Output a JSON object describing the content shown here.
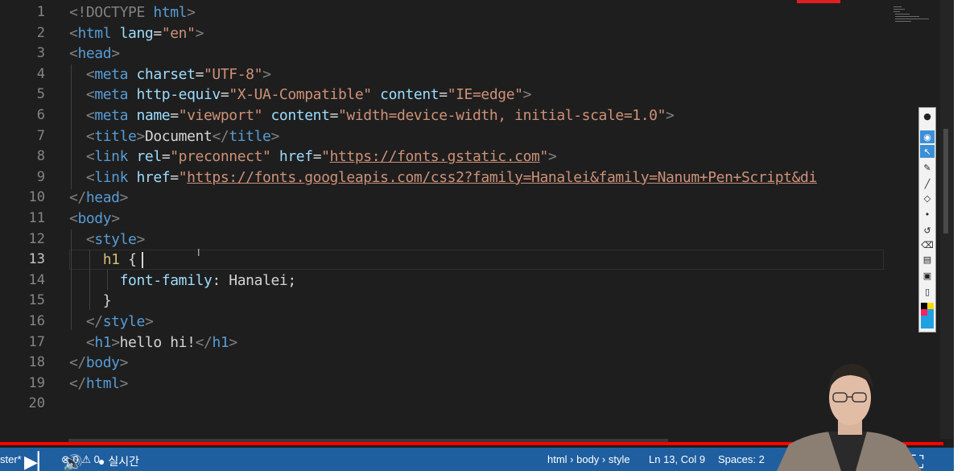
{
  "editor": {
    "current_line": 13,
    "line_numbers": [
      "1",
      "2",
      "3",
      "4",
      "5",
      "6",
      "7",
      "8",
      "9",
      "10",
      "11",
      "12",
      "13",
      "14",
      "15",
      "16",
      "17",
      "18",
      "19",
      "20"
    ],
    "lines": [
      [
        {
          "t": "<!DOCTYPE ",
          "c": "brk"
        },
        {
          "t": "html",
          "c": "tag"
        },
        {
          "t": ">",
          "c": "brk"
        }
      ],
      [
        {
          "t": "<",
          "c": "brk"
        },
        {
          "t": "html",
          "c": "tag"
        },
        {
          "t": " lang",
          "c": "attr"
        },
        {
          "t": "=",
          "c": "txt"
        },
        {
          "t": "\"en\"",
          "c": "str"
        },
        {
          "t": ">",
          "c": "brk"
        }
      ],
      [
        {
          "t": "<",
          "c": "brk"
        },
        {
          "t": "head",
          "c": "tag"
        },
        {
          "t": ">",
          "c": "brk"
        }
      ],
      [
        {
          "t": "  <",
          "c": "brk"
        },
        {
          "t": "meta",
          "c": "tag"
        },
        {
          "t": " charset",
          "c": "attr"
        },
        {
          "t": "=",
          "c": "txt"
        },
        {
          "t": "\"UTF-8\"",
          "c": "str"
        },
        {
          "t": ">",
          "c": "brk"
        }
      ],
      [
        {
          "t": "  <",
          "c": "brk"
        },
        {
          "t": "meta",
          "c": "tag"
        },
        {
          "t": " http-equiv",
          "c": "attr"
        },
        {
          "t": "=",
          "c": "txt"
        },
        {
          "t": "\"X-UA-Compatible\"",
          "c": "str"
        },
        {
          "t": " content",
          "c": "attr"
        },
        {
          "t": "=",
          "c": "txt"
        },
        {
          "t": "\"IE=edge\"",
          "c": "str"
        },
        {
          "t": ">",
          "c": "brk"
        }
      ],
      [
        {
          "t": "  <",
          "c": "brk"
        },
        {
          "t": "meta",
          "c": "tag"
        },
        {
          "t": " name",
          "c": "attr"
        },
        {
          "t": "=",
          "c": "txt"
        },
        {
          "t": "\"viewport\"",
          "c": "str"
        },
        {
          "t": " content",
          "c": "attr"
        },
        {
          "t": "=",
          "c": "txt"
        },
        {
          "t": "\"width=device-width, initial-scale=1.0\"",
          "c": "str"
        },
        {
          "t": ">",
          "c": "brk"
        }
      ],
      [
        {
          "t": "  <",
          "c": "brk"
        },
        {
          "t": "title",
          "c": "tag"
        },
        {
          "t": ">",
          "c": "brk"
        },
        {
          "t": "Document",
          "c": "txt"
        },
        {
          "t": "</",
          "c": "brk"
        },
        {
          "t": "title",
          "c": "tag"
        },
        {
          "t": ">",
          "c": "brk"
        }
      ],
      [
        {
          "t": "  <",
          "c": "brk"
        },
        {
          "t": "link",
          "c": "tag"
        },
        {
          "t": " rel",
          "c": "attr"
        },
        {
          "t": "=",
          "c": "txt"
        },
        {
          "t": "\"preconnect\"",
          "c": "str"
        },
        {
          "t": " href",
          "c": "attr"
        },
        {
          "t": "=",
          "c": "txt"
        },
        {
          "t": "\"",
          "c": "str"
        },
        {
          "t": "https://fonts.gstatic.com",
          "c": "url"
        },
        {
          "t": "\"",
          "c": "str"
        },
        {
          "t": ">",
          "c": "brk"
        }
      ],
      [
        {
          "t": "  <",
          "c": "brk"
        },
        {
          "t": "link",
          "c": "tag"
        },
        {
          "t": " href",
          "c": "attr"
        },
        {
          "t": "=",
          "c": "txt"
        },
        {
          "t": "\"",
          "c": "str"
        },
        {
          "t": "https://fonts.googleapis.com/css2?family=Hanalei&family=Nanum+Pen+Script&di",
          "c": "url"
        }
      ],
      [
        {
          "t": "</",
          "c": "brk"
        },
        {
          "t": "head",
          "c": "tag"
        },
        {
          "t": ">",
          "c": "brk"
        }
      ],
      [
        {
          "t": "<",
          "c": "brk"
        },
        {
          "t": "body",
          "c": "tag"
        },
        {
          "t": ">",
          "c": "brk"
        }
      ],
      [
        {
          "t": "  <",
          "c": "brk"
        },
        {
          "t": "style",
          "c": "tag"
        },
        {
          "t": ">",
          "c": "brk"
        }
      ],
      [
        {
          "t": "    h1 ",
          "c": "sel"
        },
        {
          "t": "{",
          "c": "txt"
        }
      ],
      [
        {
          "t": "      font-family",
          "c": "prop"
        },
        {
          "t": ": Hanalei;",
          "c": "txt"
        }
      ],
      [
        {
          "t": "    }",
          "c": "txt"
        }
      ],
      [
        {
          "t": "  </",
          "c": "brk"
        },
        {
          "t": "style",
          "c": "tag"
        },
        {
          "t": ">",
          "c": "brk"
        }
      ],
      [
        {
          "t": "  <",
          "c": "brk"
        },
        {
          "t": "h1",
          "c": "tag"
        },
        {
          "t": ">",
          "c": "brk"
        },
        {
          "t": "hello hi!",
          "c": "txt"
        },
        {
          "t": "</",
          "c": "brk"
        },
        {
          "t": "h1",
          "c": "tag"
        },
        {
          "t": ">",
          "c": "brk"
        }
      ],
      [
        {
          "t": "</",
          "c": "brk"
        },
        {
          "t": "body",
          "c": "tag"
        },
        {
          "t": ">",
          "c": "brk"
        }
      ],
      [
        {
          "t": "</",
          "c": "brk"
        },
        {
          "t": "html",
          "c": "tag"
        },
        {
          "t": ">",
          "c": "brk"
        }
      ],
      []
    ]
  },
  "statusbar": {
    "branch_fragment": "ster*",
    "problems": "⊗ 0 ⚠ 0",
    "live_label": "● 실시간",
    "breadcrumb": "html › body › style",
    "cursor_position": "Ln 13, Col 9",
    "indentation": "Spaces: 2"
  },
  "player": {
    "play_next": "▶▏",
    "volume": "🔊",
    "settings": "⚙",
    "miniplayer": "⧉",
    "theater": "▭",
    "fullscreen": "⛶"
  },
  "colors": {
    "editor_bg": "#1e1e1e",
    "statusbar_bg": "#1f5fa0",
    "progress": "#ff0000",
    "tag": "#569cd6",
    "attribute": "#9cdcfe",
    "string": "#ce9178"
  }
}
